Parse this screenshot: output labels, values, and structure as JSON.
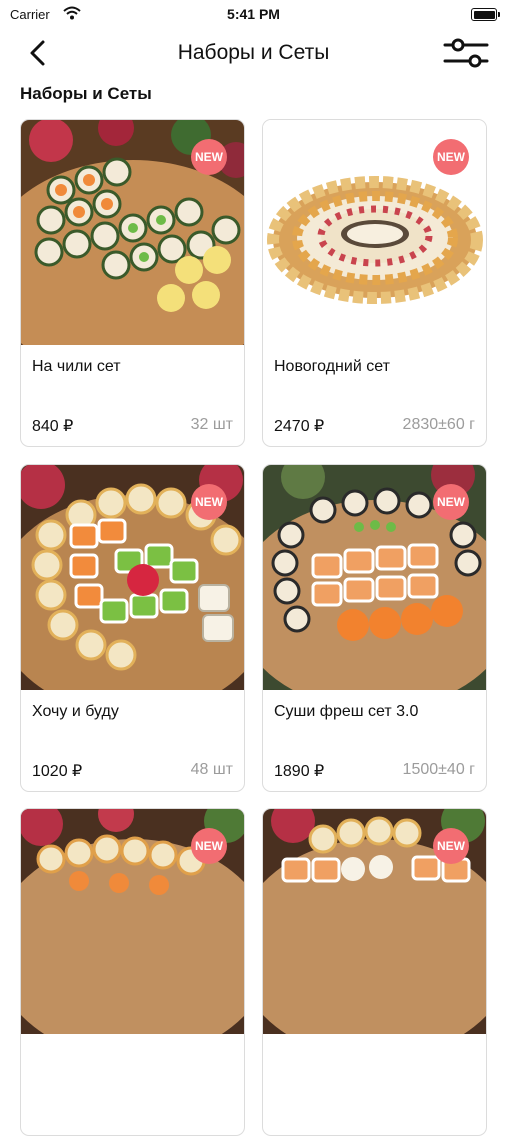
{
  "status_bar": {
    "carrier": "Carrier",
    "time": "5:41 PM"
  },
  "nav": {
    "title": "Наборы и Сеты",
    "back_icon": "chevron-left-icon",
    "filter_icon": "sliders-icon"
  },
  "section_title": "Наборы и Сеты",
  "products": [
    {
      "name": "На чили сет",
      "price": "840 ₽",
      "weight": "32 шт",
      "badge": "NEW"
    },
    {
      "name": "Новогодний сет",
      "price": "2470 ₽",
      "weight": "2830±60 г",
      "badge": "NEW"
    },
    {
      "name": "Хочу и буду",
      "price": "1020 ₽",
      "weight": "48 шт",
      "badge": "NEW"
    },
    {
      "name": "Суши фреш сет 3.0",
      "price": "1890 ₽",
      "weight": "1500±40 г",
      "badge": "NEW"
    },
    {
      "name": "",
      "price": "",
      "weight": "",
      "badge": "NEW"
    },
    {
      "name": "",
      "price": "",
      "weight": "",
      "badge": "NEW"
    }
  ],
  "colors": {
    "badge": "#f26d72",
    "weight_text": "#9c9c9c",
    "card_border": "#dcdcdc",
    "wood": "#b07a45"
  }
}
